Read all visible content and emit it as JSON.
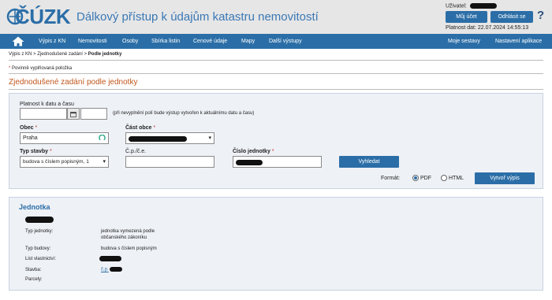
{
  "header": {
    "logo_text": "ČÚZK",
    "title": "Dálkový přístup k údajům katastru nemovitostí",
    "user_label": "Uživatel:",
    "my_account_label": "Můj účet",
    "logout_label": "Odhlásit se",
    "help_label": "?",
    "validity_text": "Platnost dat: 22.07.2024 14:55:13"
  },
  "nav": {
    "items": [
      "Výpis z KN",
      "Nemovitosti",
      "Osoby",
      "Sbírka listin",
      "Cenové údaje",
      "Mapy",
      "Další výstupy"
    ],
    "right_items": [
      "Moje sestavy",
      "Nastavení aplikace"
    ]
  },
  "breadcrumb": {
    "items": [
      "Výpis z KN",
      "Zjednodušené zadání"
    ],
    "separator": ">",
    "current": "Podle jednotky"
  },
  "required_note": {
    "star": "*",
    "text": "Povinně vyplňovaná položka"
  },
  "page_title": "Zjednodušené zadání podle jednotky",
  "form": {
    "date_label": "Platnost k datu a času",
    "date_value": "",
    "time_value": "",
    "date_hint": "(při nevyplnění polí bude výstup vytvořen k aktuálnímu datu a času)",
    "obec_label": "Obec",
    "obec_value": "Praha",
    "cast_obce_label": "Část obce",
    "typ_stavby_label": "Typ stavby",
    "typ_stavby_value": "budova s číslem popisným, 1",
    "cp_ce_label": "Č.p./č.e.",
    "cp_ce_value": "",
    "cislo_jednotky_label": "Číslo jednotky",
    "required_star": "*",
    "search_label": "Vyhledat",
    "format_label": "Formát:",
    "format_options": [
      "PDF",
      "HTML"
    ],
    "format_selected": "PDF",
    "create_label": "Vytvoř výpis"
  },
  "result": {
    "title": "Jednotka",
    "rows": [
      {
        "label": "Typ jednotky:",
        "value": "jednotka vymezená podle",
        "value2": "občanského zákoníku"
      },
      {
        "label": "Typ budovy:",
        "value": "budova s číslem popisným"
      },
      {
        "label": "List vlastnictví:",
        "value": ""
      },
      {
        "label": "Stavba:",
        "value": "č.p."
      },
      {
        "label": "Parcely:",
        "value": ""
      }
    ]
  },
  "colors": {
    "primary": "#2b6ea7",
    "title_orange": "#c0561c",
    "panel_bg": "#eef1f6",
    "header_bg": "#e6e6e6"
  },
  "icons": [
    "home-icon",
    "calendar-icon",
    "loading-spinner-icon",
    "chevron-down-icon",
    "help-icon"
  ]
}
